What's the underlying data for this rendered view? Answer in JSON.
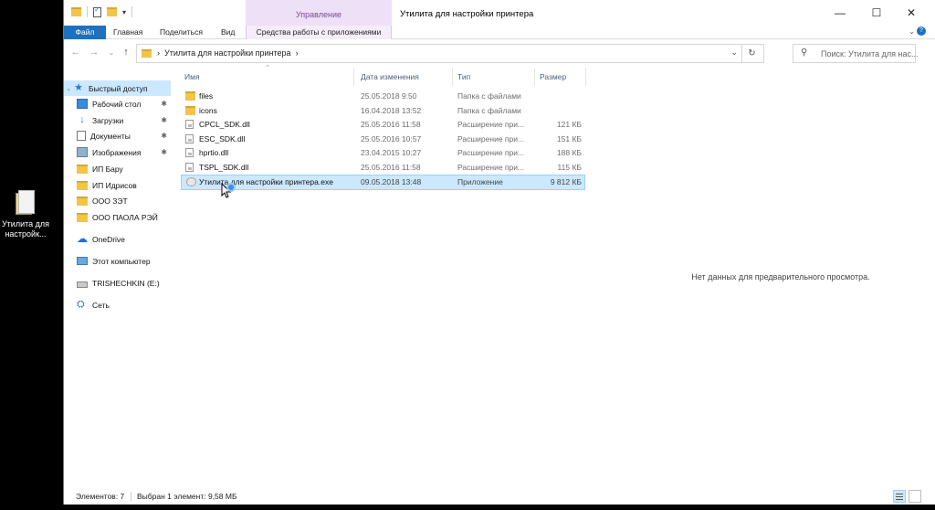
{
  "desktop": {
    "icon_label": "Утилита для настройк..."
  },
  "window": {
    "title": "Утилита для настройки принтера",
    "manage_tab": "Управление",
    "controls": {
      "minimize": "—",
      "maximize": "☐",
      "close": "✕"
    }
  },
  "ribbon": {
    "tabs": [
      "Файл",
      "Главная",
      "Поделиться",
      "Вид",
      "Средства работы с приложениями"
    ]
  },
  "address": {
    "path": "Утилита для настройки принтера",
    "search_placeholder": "Поиск: Утилита для нас..."
  },
  "nav": {
    "items": [
      {
        "label": "Быстрый доступ",
        "icon": "star-icon"
      },
      {
        "label": "Рабочий стол",
        "icon": "desktop-icon"
      },
      {
        "label": "Загрузки",
        "icon": "download-icon"
      },
      {
        "label": "Документы",
        "icon": "document-icon"
      },
      {
        "label": "Изображения",
        "icon": "image-icon"
      },
      {
        "label": "ИП Бару",
        "icon": "folder-icon"
      },
      {
        "label": "ИП Идрисов",
        "icon": "folder-icon"
      },
      {
        "label": "ООО ЗЭТ",
        "icon": "folder-icon"
      },
      {
        "label": "ООО ПАОЛА РЭЙ",
        "icon": "folder-icon"
      },
      {
        "label": "OneDrive",
        "icon": "onedrive-icon"
      },
      {
        "label": "Этот компьютер",
        "icon": "computer-icon"
      },
      {
        "label": "TRISHECHKIN (E:)",
        "icon": "drive-icon"
      },
      {
        "label": "Сеть",
        "icon": "network-icon"
      }
    ]
  },
  "columns": {
    "name": "Имя",
    "date": "Дата изменения",
    "type": "Тип",
    "size": "Размер"
  },
  "files": [
    {
      "name": "files",
      "date": "25.05.2018 9:50",
      "type": "Папка с файлами",
      "size": "",
      "icon": "folder"
    },
    {
      "name": "icons",
      "date": "16.04.2018 13:52",
      "type": "Папка с файлами",
      "size": "",
      "icon": "folder"
    },
    {
      "name": "CPCL_SDK.dll",
      "date": "25.05.2016 11:58",
      "type": "Расширение при...",
      "size": "121 КБ",
      "icon": "dll"
    },
    {
      "name": "ESC_SDK.dll",
      "date": "25.05.2016 10:57",
      "type": "Расширение при...",
      "size": "151 КБ",
      "icon": "dll"
    },
    {
      "name": "hprtio.dll",
      "date": "23.04.2015 10:27",
      "type": "Расширение при...",
      "size": "188 КБ",
      "icon": "dll"
    },
    {
      "name": "TSPL_SDK.dll",
      "date": "25.05.2016 11:58",
      "type": "Расширение при...",
      "size": "115 КБ",
      "icon": "dll"
    },
    {
      "name": "Утилита для настройки принтера.exe",
      "date": "09.05.2018 13:48",
      "type": "Приложение",
      "size": "9 812 КБ",
      "icon": "exe"
    }
  ],
  "preview": {
    "empty_text": "Нет данных для предварительного просмотра."
  },
  "status": {
    "count": "Элементов: 7",
    "selection": "Выбран 1 элемент: 9,58 МБ"
  }
}
